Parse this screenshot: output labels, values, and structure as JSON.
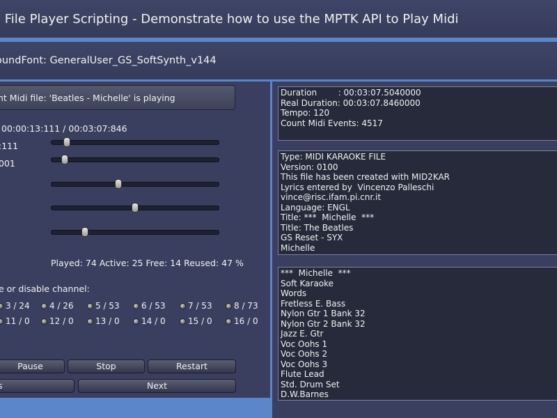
{
  "header": {
    "title": "i File Player Scripting - Demonstrate how to use the MPTK API to Play Midi",
    "soundfont": "oundFont: GeneralUser_GS_SoftSynth_v144"
  },
  "player": {
    "status": "nt Midi file: 'Beatles - Michelle' is playing",
    "time": "00:00:13:111 / 00:03:07:846",
    "tick": ":111",
    "speed": "001",
    "stats": "Played: 74 Active: 25 Free: 14 Reused: 47 %",
    "sliders": [
      {
        "name": "position",
        "value": 0.09
      },
      {
        "name": "tick",
        "value": 0.08
      },
      {
        "name": "speed",
        "value": 0.4
      },
      {
        "name": "volume",
        "value": 0.5
      },
      {
        "name": "transpose",
        "value": 0.2
      }
    ]
  },
  "channels": {
    "label": "e or disable channel:",
    "row1": [
      "3 / 24",
      "4 / 26",
      "5 / 53",
      "6 / 53",
      "7 / 53",
      "8 / 73"
    ],
    "row2": [
      "11 / 0",
      "12 / 0",
      "13 / 0",
      "14 / 0",
      "15 / 0",
      "16 / 0"
    ]
  },
  "buttons": {
    "pause": "Pause",
    "stop": "Stop",
    "restart": "Restart",
    "previous": "s",
    "next": "Next"
  },
  "info": {
    "duration": [
      "Duration        : 00:03:07.5040000",
      "Real Duration: 00:03:07.8460000",
      "Tempo: 120",
      "Count Midi Events: 4517"
    ],
    "header_text": [
      "Type: MIDI KARAOKE FILE",
      "Version: 0100",
      "This file has been created with MID2KAR",
      "Lyrics entered by  Vincenzo Palleschi",
      "vince@risc.ifam.pi.cnr.it",
      "Language: ENGL",
      "Title: ***  Michelle  ***",
      "Title: The Beatles",
      "GS Reset - SYX",
      "Michelle"
    ],
    "tracks": [
      "***  Michelle  ***",
      "Soft Karaoke",
      "Words",
      "Fretless E. Bass",
      "Nylon Gtr 1 Bank 32",
      "Nylon Gtr 2 Bank 32",
      "Jazz E. Gtr",
      "Voc Oohs 1",
      "Voc Oohs 2",
      "Voc Oohs 3",
      "Flute Lead",
      "Std. Drum Set",
      "D.W.Barnes"
    ]
  }
}
